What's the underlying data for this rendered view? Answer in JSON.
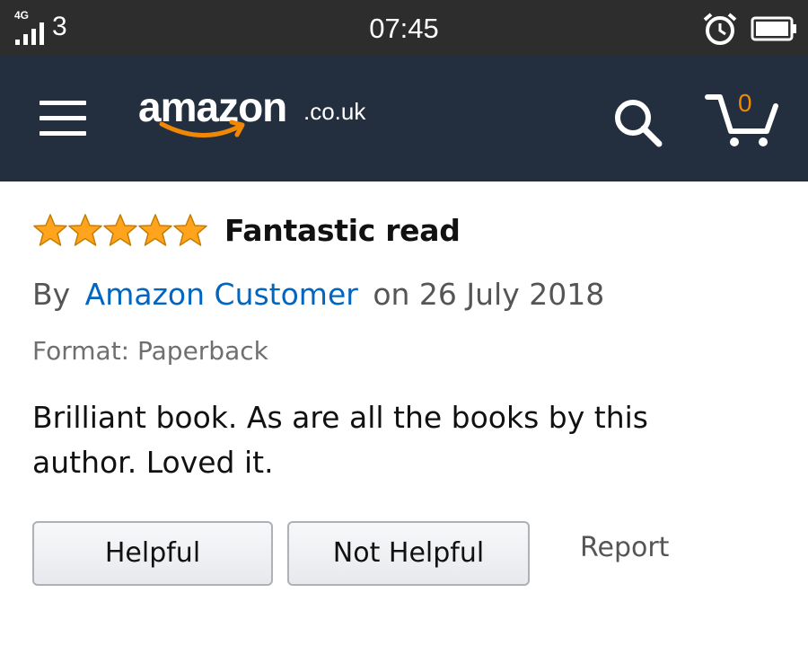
{
  "status_bar": {
    "network_label": "4G",
    "carrier_label": "3",
    "time": "07:45",
    "icons": [
      "signal-icon",
      "alarm-icon",
      "battery-icon"
    ]
  },
  "header": {
    "logo_text": "amazon",
    "logo_domain": ".co.uk",
    "cart_count": "0",
    "icons": [
      "menu-icon",
      "search-icon",
      "cart-icon"
    ],
    "colors": {
      "background": "#232f3e",
      "smile": "#f08804"
    }
  },
  "review": {
    "rating": 5,
    "rating_max": 5,
    "title": "Fantastic read",
    "by_label": "By",
    "author": "Amazon Customer",
    "date_text": "on 26 July 2018",
    "format_text": "Format: Paperback",
    "body": "Brilliant book. As are all the books by this author. Loved it.",
    "colors": {
      "star": "#ffa41c",
      "author_link": "#0066c0"
    }
  },
  "actions": {
    "helpful_label": "Helpful",
    "not_helpful_label": "Not Helpful",
    "report_label": "Report"
  }
}
